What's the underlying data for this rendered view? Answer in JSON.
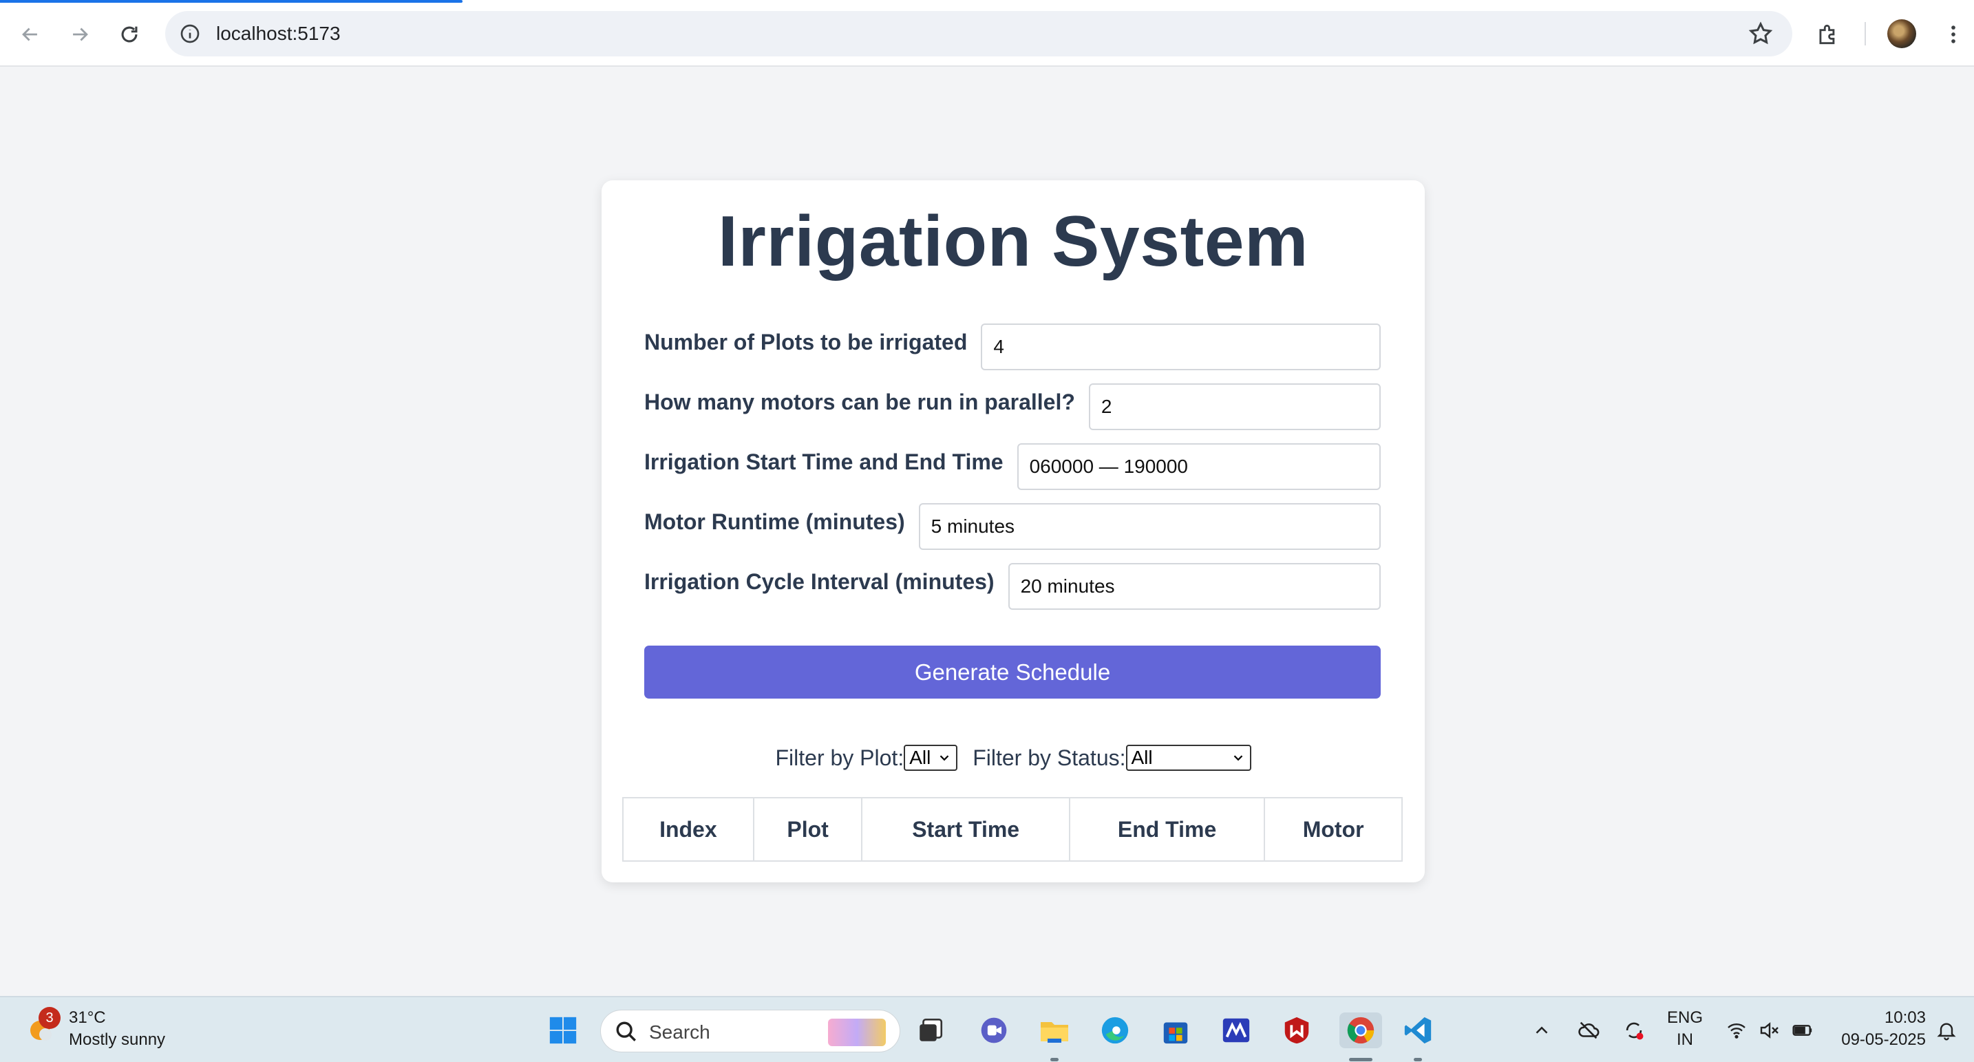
{
  "browser": {
    "url": "localhost:5173",
    "icons": [
      "back-arrow-icon",
      "forward-arrow-icon",
      "reload-icon",
      "site-info-icon",
      "bookmark-star-icon",
      "extensions-icon",
      "profile-avatar",
      "more-menu-icon"
    ]
  },
  "app": {
    "title": "Irrigation System",
    "form": {
      "plots_label": "Number of Plots to be irrigated",
      "plots_value": "4",
      "motors_label": "How many motors can be run in parallel?",
      "motors_value": "2",
      "time_label": "Irrigation Start Time and End Time",
      "time_value": "060000 — 190000",
      "runtime_label": "Motor Runtime (minutes)",
      "runtime_value": "5 minutes",
      "interval_label": "Irrigation Cycle Interval (minutes)",
      "interval_value": "20 minutes"
    },
    "generate_button": "Generate Schedule",
    "filters": {
      "plot_label": "Filter by Plot:",
      "plot_value": "All",
      "status_label": "Filter by Status:",
      "status_value": "All"
    },
    "table": {
      "columns": [
        "Index",
        "Plot",
        "Start Time",
        "End Time",
        "Motor"
      ]
    },
    "accent_color": "#6366d8"
  },
  "taskbar": {
    "weather": {
      "temp": "31°C",
      "condition": "Mostly sunny",
      "badge": "3"
    },
    "search_label": "Search",
    "language": {
      "line1": "ENG",
      "line2": "IN"
    },
    "clock": {
      "time": "10:03",
      "date": "09-05-2025"
    }
  }
}
